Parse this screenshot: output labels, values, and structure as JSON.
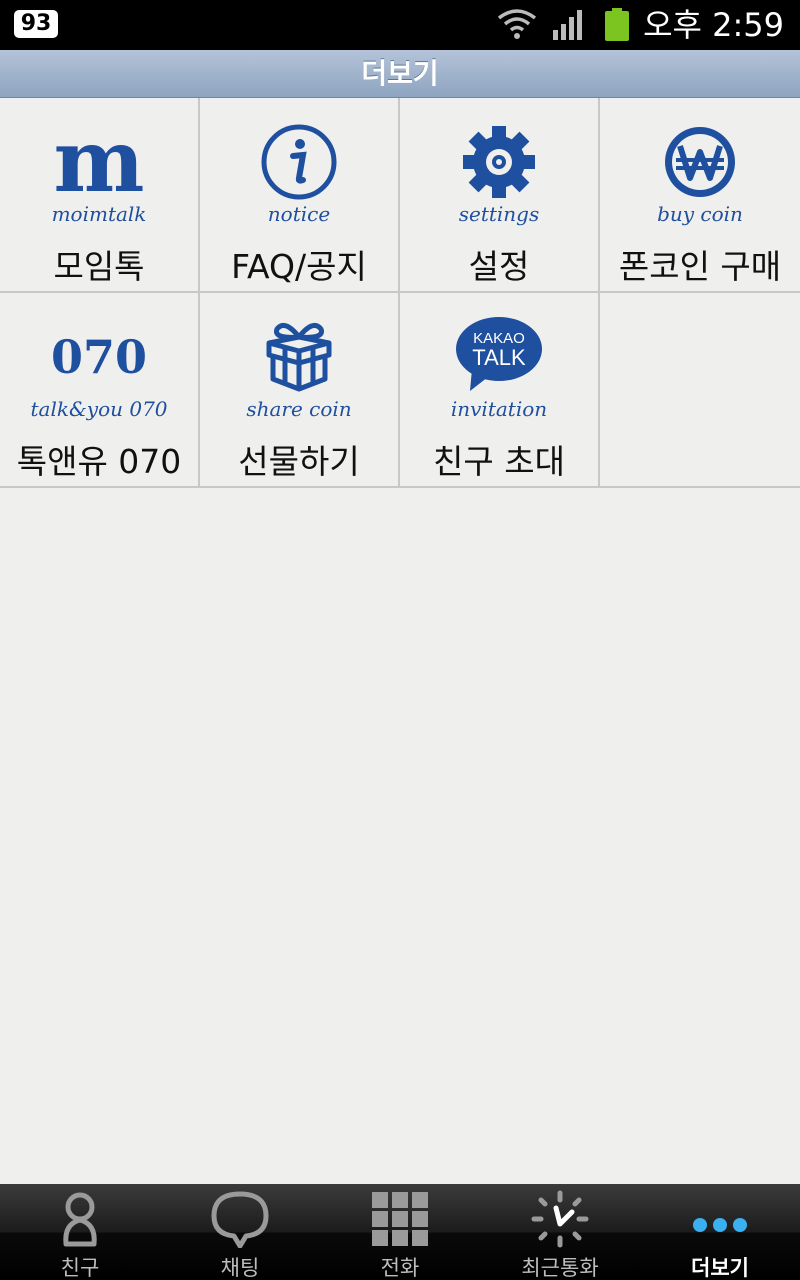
{
  "status_bar": {
    "notification_count": "93",
    "time": "오후 2:59",
    "icons": [
      "wifi-icon",
      "signal-icon",
      "battery-icon"
    ],
    "battery_color": "#7cc41f"
  },
  "header": {
    "title": "더보기"
  },
  "menu": {
    "accent_color": "#1f4f9f",
    "items": [
      {
        "icon": "moimtalk-icon",
        "glyph": "m",
        "subtitle": "moimtalk",
        "label": "모임톡"
      },
      {
        "icon": "notice-icon",
        "subtitle": "notice",
        "label": "FAQ/공지"
      },
      {
        "icon": "settings-icon",
        "subtitle": "settings",
        "label": "설정"
      },
      {
        "icon": "coin-icon",
        "subtitle": "buy coin",
        "label": "폰코인 구매"
      },
      {
        "icon": "talkyou-icon",
        "glyph": "070",
        "subtitle": "talk&you 070",
        "label": "톡앤유 070"
      },
      {
        "icon": "gift-icon",
        "subtitle": "share coin",
        "label": "선물하기"
      },
      {
        "icon": "kakaotalk-icon",
        "bubble_top": "KAKAO",
        "bubble_bottom": "TALK",
        "subtitle": "invitation",
        "label": "친구 초대"
      }
    ]
  },
  "bottom_nav": {
    "active_index": 4,
    "items": [
      {
        "icon": "person-icon",
        "label": "친구"
      },
      {
        "icon": "speech-bubble-icon",
        "label": "채팅"
      },
      {
        "icon": "dialpad-icon",
        "label": "전화"
      },
      {
        "icon": "clock-icon",
        "label": "최근통화"
      },
      {
        "icon": "more-dots-icon",
        "label": "더보기"
      }
    ]
  }
}
